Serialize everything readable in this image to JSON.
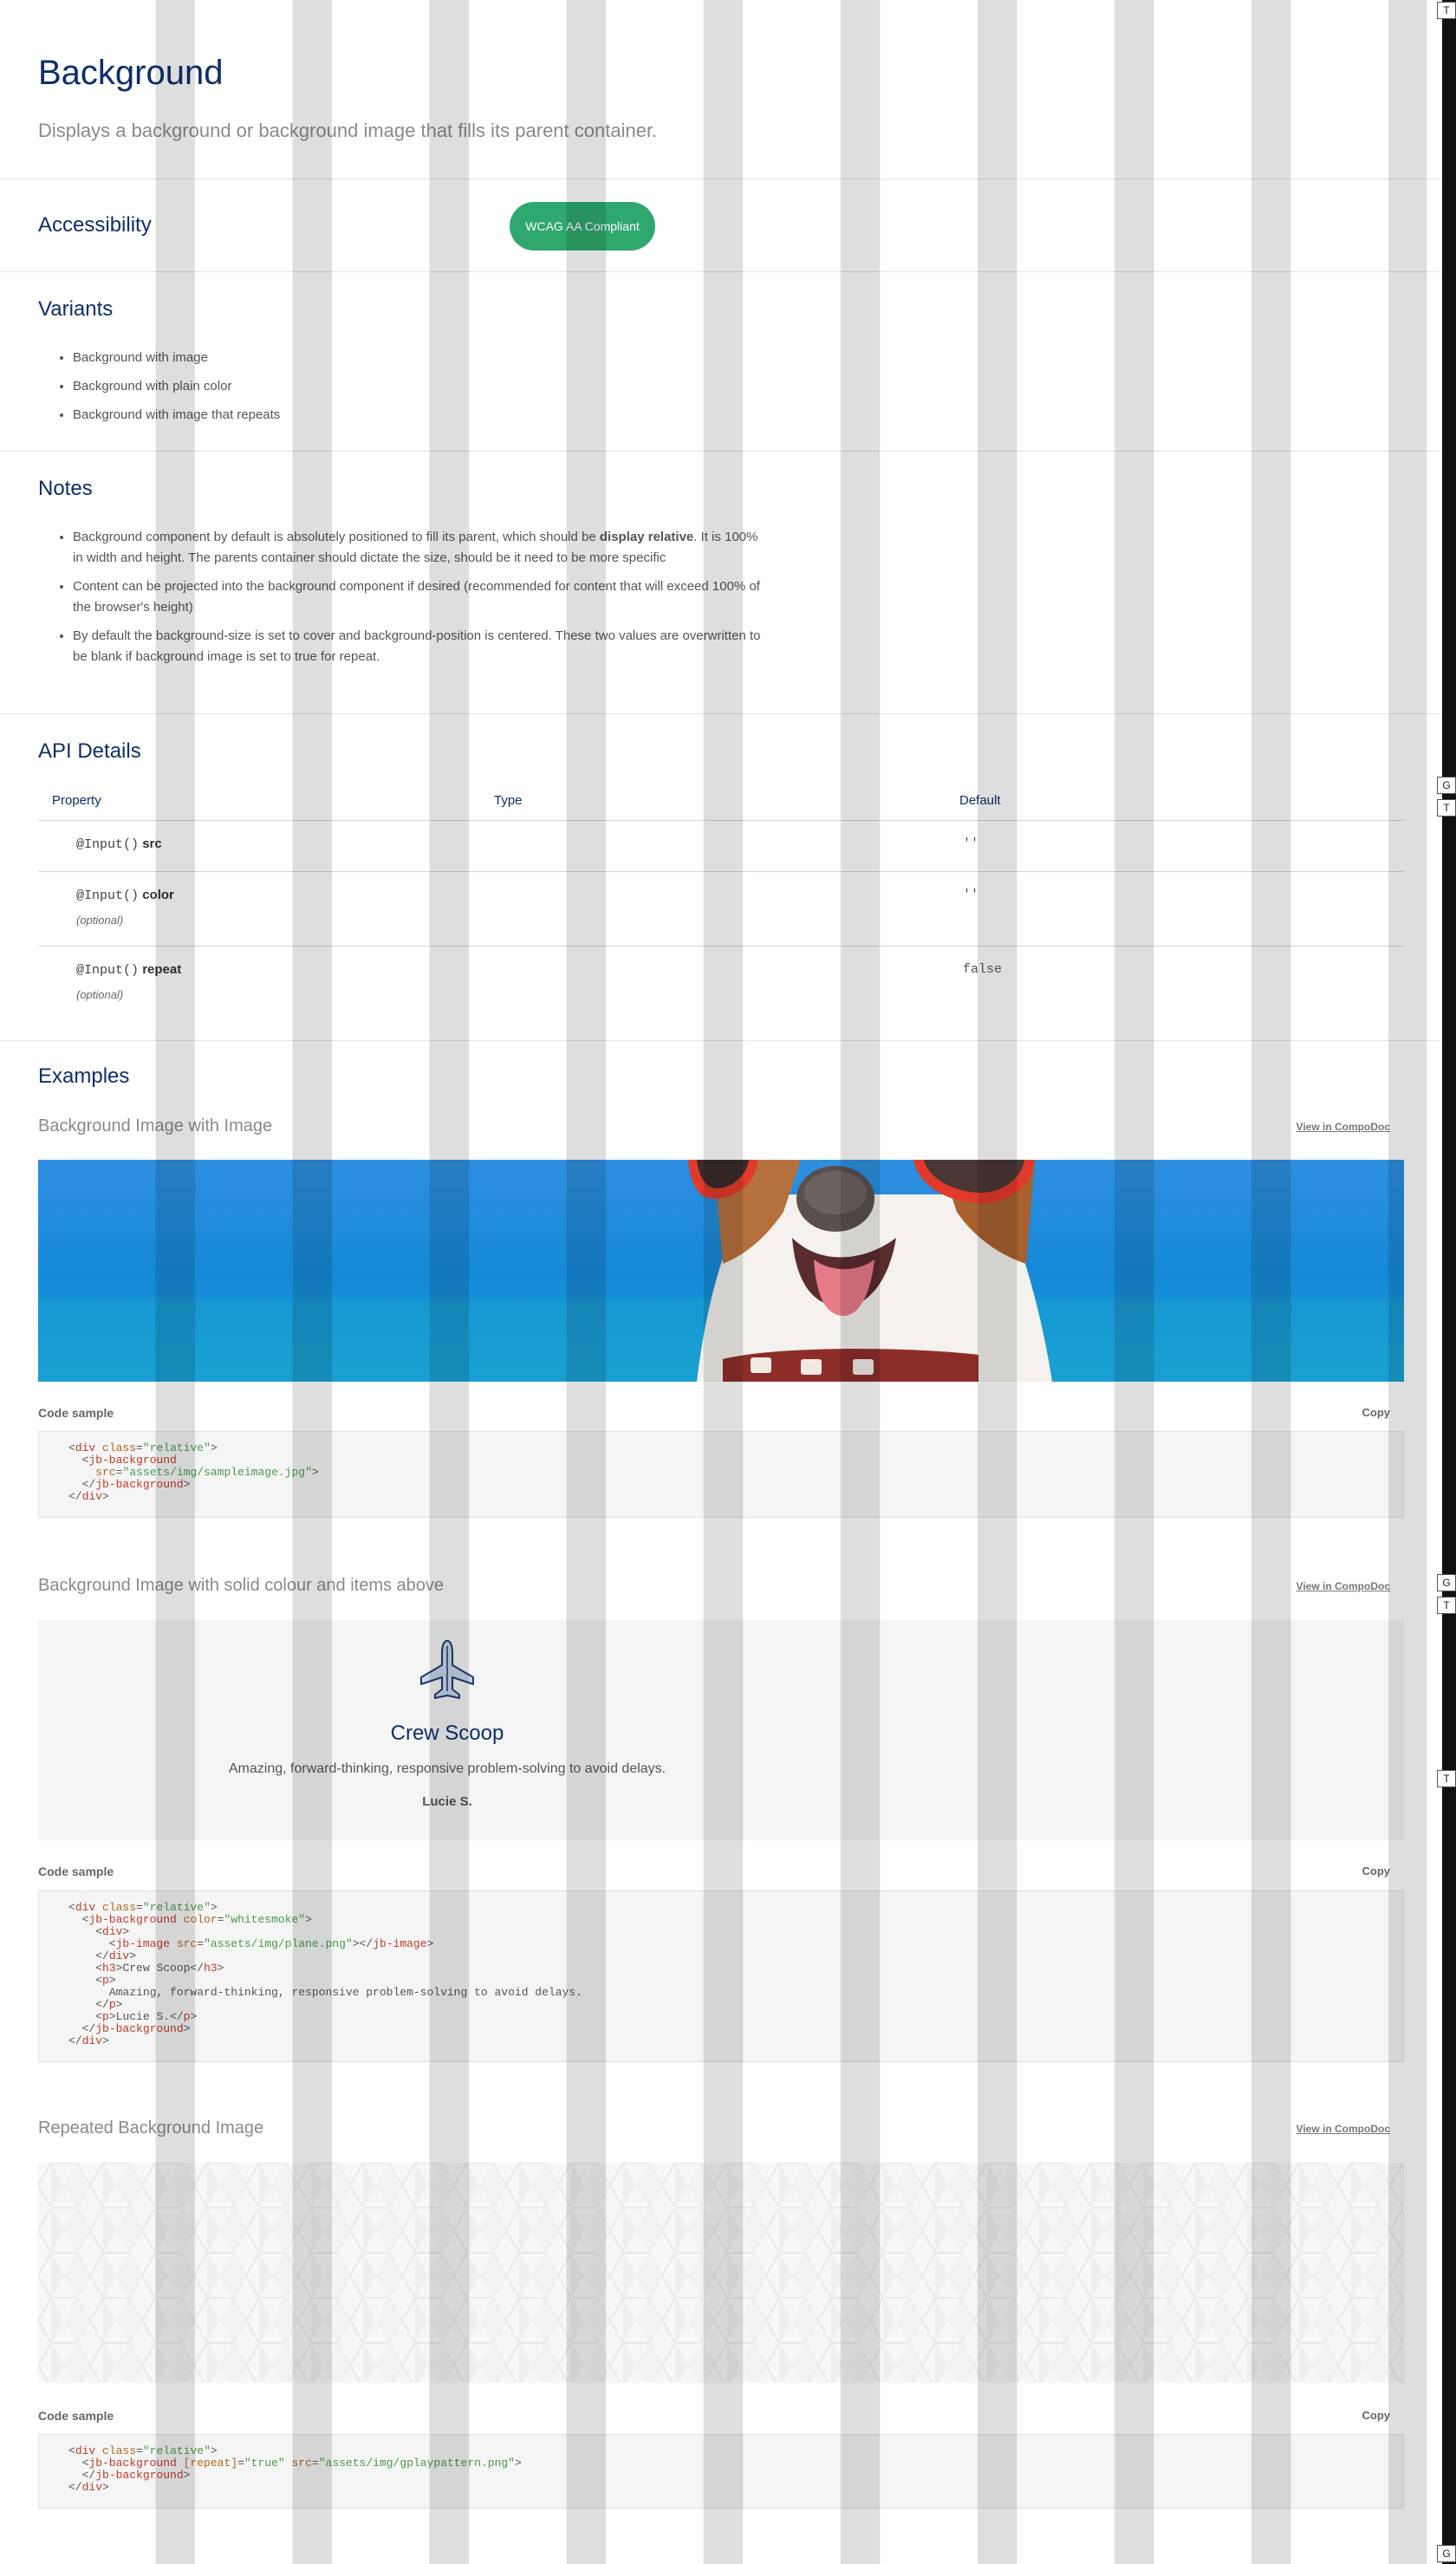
{
  "header": {
    "title": "Background",
    "subtitle": "Displays a background or background image that fills its parent container."
  },
  "accessibility": {
    "title": "Accessibility",
    "badge": "WCAG AA Compliant"
  },
  "variants": {
    "title": "Variants",
    "items": [
      "Background with image",
      "Background with plain color",
      "Background with image that repeats"
    ]
  },
  "notes": {
    "title": "Notes",
    "item1_pre": "Background component by default is absolutely positioned to fill its parent, which should be ",
    "item1_bold": "display relative",
    "item1_post": ". It is 100% in width and height. The parents container should dictate the size, should be it need to be more specific",
    "item2": "Content can be projected into the background component if desired (recommended for content that will exceed 100% of the browser's height)",
    "item3": "By default the background-size is set to cover and background-position is centered. These two values are overwritten to be blank if background image is set to true for repeat."
  },
  "api": {
    "title": "API Details",
    "columns": [
      "Property",
      "Type",
      "Default"
    ],
    "rows": [
      {
        "decorator": "@Input()",
        "name": "src",
        "optional": "",
        "type": "",
        "default": "''"
      },
      {
        "decorator": "@Input()",
        "name": "color",
        "optional": "(optional)",
        "type": "",
        "default": "''"
      },
      {
        "decorator": "@Input()",
        "name": "repeat",
        "optional": "(optional)",
        "type": "",
        "default": "false"
      }
    ]
  },
  "examples": {
    "title": "Examples",
    "compodoc_label": "View in CompoDoc",
    "code_label": "Code sample",
    "copy_label": "Copy",
    "ex1": {
      "title": "Background Image with Image"
    },
    "ex2": {
      "title": "Background Image with solid colour and items above",
      "card_title": "Crew Scoop",
      "card_text": "Amazing, forward-thinking, responsive problem-solving to avoid delays.",
      "card_author": "Lucie S."
    },
    "ex3": {
      "title": "Repeated Background Image"
    }
  },
  "code": {
    "ex1": {
      "l1_tag": "div",
      "l1_attr": "class",
      "l1_val": "\"relative\"",
      "l2_tag": "jb-background",
      "l3_attr": "src",
      "l3_val": "\"assets/img/sampleimage.jpg\"",
      "l4_tag": "jb-background",
      "l5_tag": "div"
    },
    "ex2": {
      "l1_tag": "div",
      "l1_attr": "class",
      "l1_val": "\"relative\"",
      "l2_tag": "jb-background",
      "l2_attr": "color",
      "l2_val": "\"whitesmoke\"",
      "l3_tag": "div",
      "l4_tag": "jb-image",
      "l4_attr": "src",
      "l4_val": "\"assets/img/plane.png\"",
      "l4_close": "jb-image",
      "l5_tag": "div",
      "l6_tag": "h3",
      "l6_text": "Crew Scoop",
      "l6_close": "h3",
      "l7_tag": "p",
      "l8_text": "Amazing, forward-thinking, responsive problem-solving to avoid delays.",
      "l9_tag": "p",
      "l10_tag": "p",
      "l10_text": "Lucie S.",
      "l10_close": "p",
      "l11_tag": "jb-background",
      "l12_tag": "div"
    },
    "ex3": {
      "l1_tag": "div",
      "l1_attr": "class",
      "l1_val": "\"relative\"",
      "l2_tag": "jb-background",
      "l2_attr1": "[repeat]",
      "l2_val1": "\"true\"",
      "l2_attr2": "src",
      "l2_val2": "\"assets/img/gplaypattern.png\"",
      "l3_tag": "jb-background",
      "l4_tag": "div"
    }
  },
  "side_markers": [
    "T",
    "G",
    "T",
    "G",
    "T",
    "T",
    "G"
  ],
  "colors": {
    "heading": "#0e2e6d",
    "badge": "#2fa86f",
    "sky": "#1a8fdc"
  },
  "icons": {
    "card_icon": "plane-icon"
  }
}
